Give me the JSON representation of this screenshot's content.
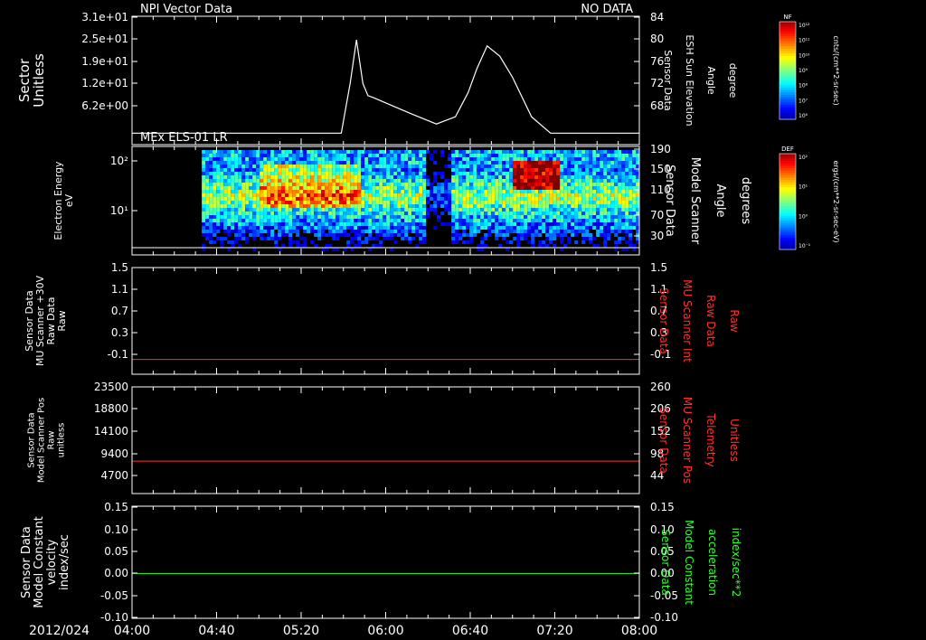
{
  "date_label": "2012/024",
  "time_ticks": [
    "04:00",
    "04:40",
    "05:20",
    "06:00",
    "06:40",
    "07:20",
    "08:00"
  ],
  "colors": {
    "red": "#ff3030",
    "green": "#33ff33",
    "white": "#ffffff",
    "black": "#000000"
  },
  "colorbars": [
    {
      "label": "NF",
      "unit": "cnts/(cm**2-sr-sec)",
      "ticks": [
        "10¹²",
        "10¹¹",
        "10¹⁰",
        "10⁹",
        "10⁸",
        "10⁷",
        "10⁶"
      ]
    },
    {
      "label": "DEF",
      "unit": "ergs/(cm**2-sr-sec-eV)",
      "ticks": [
        "10²",
        "10¹",
        "10⁰",
        "10⁻¹"
      ]
    }
  ],
  "chart_data": [
    {
      "type": "line",
      "panel_title": "NPI Vector Data",
      "status_text": "NO DATA",
      "ylabel_left": [
        "Sector",
        "Unitless"
      ],
      "yticks_left": [
        "3.1e+01",
        "2.5e+01",
        "1.9e+01",
        "1.2e+01",
        "6.2e+00"
      ],
      "ylabel_right": [
        "Sensor Data",
        "ESH Sun Elevation",
        "Angle",
        "degree"
      ],
      "yticks_right": [
        "84",
        "80",
        "76",
        "72",
        "68"
      ],
      "ylim_right": [
        64,
        84
      ],
      "series_color": "#ffffff",
      "x_hours": [
        4.0,
        4.5,
        5.0,
        5.5,
        5.65,
        5.72,
        5.77,
        5.82,
        5.86,
        5.9,
        6.0,
        6.2,
        6.4,
        6.55,
        6.65,
        6.72,
        6.8,
        6.9,
        7.0,
        7.15,
        7.3,
        8.0
      ],
      "y": [
        65.3,
        65.3,
        65.3,
        65.3,
        65.3,
        73.5,
        80.7,
        73.5,
        71.5,
        71.2,
        70.3,
        68.5,
        66.8,
        68,
        72,
        76,
        79.7,
        78,
        74.5,
        68,
        65.3,
        65.3
      ]
    },
    {
      "type": "heatmap",
      "panel_title": "MEx ELS-01 LR",
      "ylabel_left": [
        "Electron Energy",
        "eV"
      ],
      "yticks_left": [
        "10²",
        "10¹"
      ],
      "ylabel_right": [
        "Sensor Data",
        "Model Scanner",
        "Angle",
        "degrees"
      ],
      "yticks_right": [
        "190",
        "150",
        "110",
        "70",
        "30"
      ],
      "data_start_hour": 4.55,
      "ylim_log10_eV": [
        0.24,
        2.2
      ]
    },
    {
      "type": "line",
      "ylabel_left": [
        "Sensor Data",
        "MU Scanner +30V",
        "Raw Data",
        "Raw"
      ],
      "yticks_left": [
        "1.5",
        "1.1",
        "0.7",
        "0.3",
        "-0.1"
      ],
      "ylabel_right": [
        "Sensor Data",
        "MU Scanner Int",
        "Raw Data",
        "Raw"
      ],
      "yticks_right": [
        "1.5",
        "1.1",
        "0.7",
        "0.3",
        "-0.1"
      ],
      "ylim": [
        -0.3,
        1.5
      ],
      "constant_value": -0.05,
      "series_color": "#ff3030"
    },
    {
      "type": "line",
      "ylabel_left": [
        "Sensor Data",
        "Model Scanner Pos",
        "Raw",
        "unitless"
      ],
      "yticks_left": [
        "23500",
        "18800",
        "14100",
        "9400",
        "4700"
      ],
      "ylabel_right": [
        "Sensor Data",
        "MU Scanner Pos",
        "Telemetry",
        "Unitless"
      ],
      "yticks_right": [
        "260",
        "206",
        "152",
        "98",
        "44"
      ],
      "ylim_right": [
        10,
        260
      ],
      "constant_value_right": 86,
      "series_color": "#ff3030"
    },
    {
      "type": "line",
      "ylabel_left": [
        "Sensor Data",
        "Model Constant",
        "velocity",
        "index/sec"
      ],
      "yticks_left": [
        "0.15",
        "0.10",
        "0.05",
        "0.00",
        "-0.05",
        "-0.10"
      ],
      "ylabel_right": [
        "Sensor Data",
        "Model Constant",
        "acceleration",
        "index/sec**2"
      ],
      "yticks_right": [
        "0.15",
        "0.10",
        "0.05",
        "0.00",
        "-0.05",
        "-0.10"
      ],
      "ylim": [
        -0.1,
        0.15
      ],
      "constant_value": 0.0,
      "series_color": "#33ff33"
    }
  ]
}
